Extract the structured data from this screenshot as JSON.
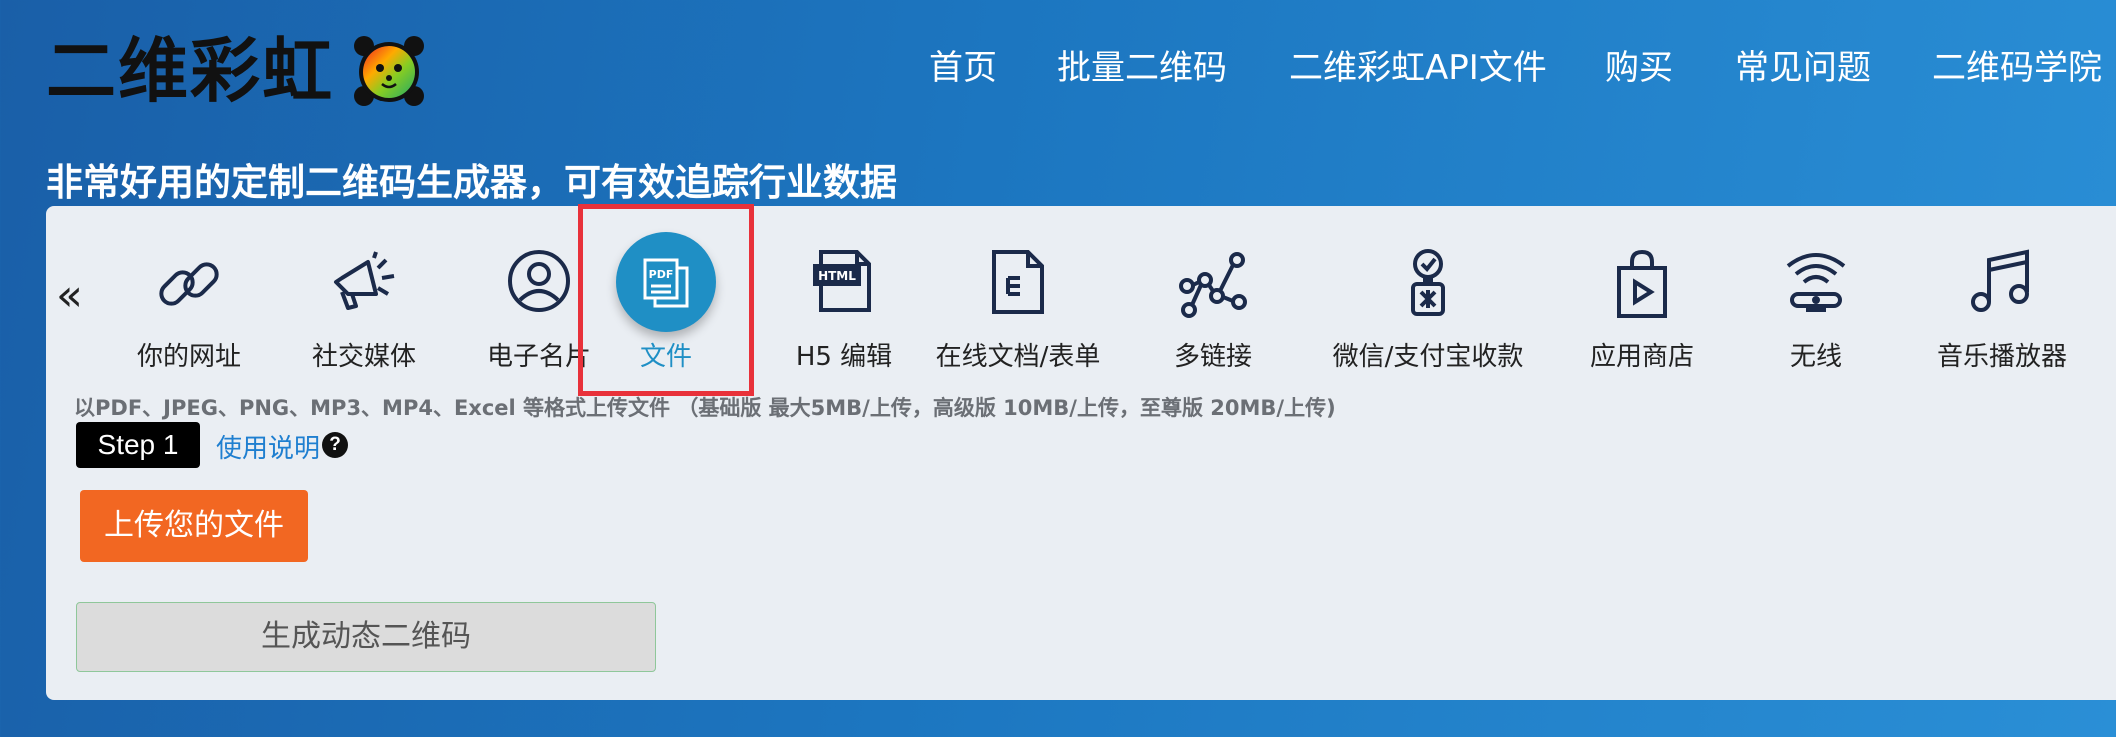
{
  "brand": {
    "logo_text": "二维彩虹",
    "logo_icon": "rainbow-bear-icon"
  },
  "nav": {
    "items": [
      "首页",
      "批量二维码",
      "二维彩虹API文件",
      "购买",
      "常见问题",
      "二维码学院"
    ]
  },
  "tagline": "非常好用的定制二维码生成器，可有效追踪行业数据",
  "categories": [
    {
      "label": "你的网址",
      "icon": "link-icon"
    },
    {
      "label": "社交媒体",
      "icon": "megaphone-icon"
    },
    {
      "label": "电子名片",
      "icon": "user-circle-icon"
    },
    {
      "label": "文件",
      "icon": "pdf-file-icon",
      "active": true
    },
    {
      "label": "H5 编辑",
      "icon": "html-file-icon"
    },
    {
      "label": "在线文档/表单",
      "icon": "document-icon"
    },
    {
      "label": "多链接",
      "icon": "network-nodes-icon"
    },
    {
      "label": "微信/支付宝收款",
      "icon": "payment-icon"
    },
    {
      "label": "应用商店",
      "icon": "app-store-bag-icon"
    },
    {
      "label": "无线",
      "icon": "wifi-router-icon"
    },
    {
      "label": "音乐播放器",
      "icon": "music-note-icon"
    }
  ],
  "prev_arrow": "«",
  "upload_hint": "以PDF、JPEG、PNG、MP3、MP4、Excel 等格式上传文件 （基础版 最大5MB/上传，高级版 10MB/上传，至尊版 20MB/上传)",
  "step": {
    "label": "Step 1"
  },
  "help_link": "使用说明",
  "help_icon_glyph": "?",
  "upload_button": "上传您的文件",
  "generate_button": "生成动态二维码",
  "colors": {
    "accent_blue": "#1f8fc5",
    "upload_orange": "#f26722",
    "highlight_red": "#e8313a"
  }
}
